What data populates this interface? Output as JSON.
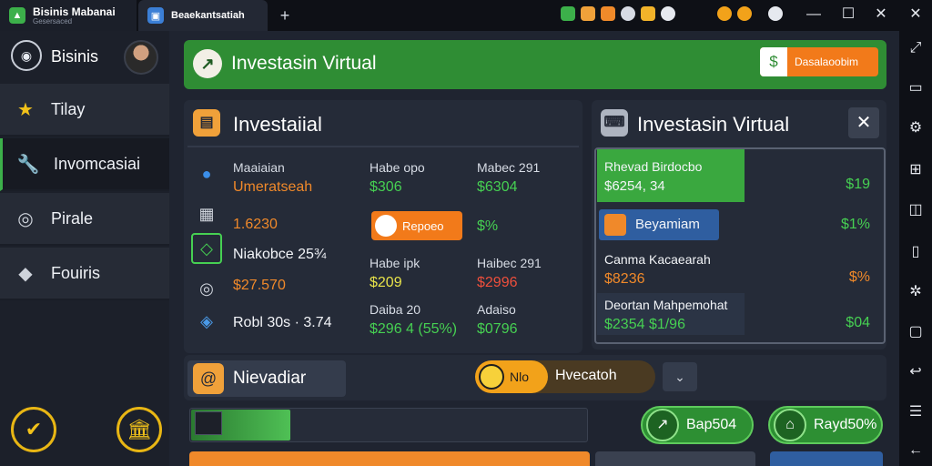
{
  "window": {
    "tab1_title": "Bisinis Mabanai",
    "tab1_sub": "Gesersaced",
    "tab2_title": "Beaekantsatiah",
    "new_tab": "+",
    "controls": {
      "minimize": "—",
      "maximize": "☐",
      "close": "✕"
    }
  },
  "sidebar": {
    "header_label": "Bisinis",
    "items": [
      {
        "label": "Tilay",
        "icon": "star-icon"
      },
      {
        "label": "Invomcasiai",
        "icon": "wrench-icon"
      },
      {
        "label": "Pirale",
        "icon": "pin-icon"
      },
      {
        "label": "Fouiris",
        "icon": "tag-icon"
      }
    ],
    "bottom_buttons": [
      "check-icon",
      "bank-icon"
    ]
  },
  "banner": {
    "title": "Investasin Virtual",
    "button_label": "Dasalaoobim",
    "accent": "#2f8d34",
    "button_color": "#f27a1a"
  },
  "invest_panel": {
    "title": "Investaiial",
    "rows": [
      {
        "label": "Maaiaian",
        "value": "Umeratseah"
      },
      {
        "value": "1.6230"
      },
      {
        "label": "Niakobce 25¾"
      },
      {
        "value": "$27.570"
      },
      {
        "label": "Robl 30s · 3.74"
      }
    ],
    "col2": [
      {
        "label": "Habe opo",
        "value": "$306"
      },
      {
        "badge": "Repoeo"
      },
      {
        "label": "Habe ipk",
        "value": "$209"
      },
      {
        "label": "Daiba 20",
        "value": "$296 4 (55%)"
      }
    ],
    "col3": [
      {
        "label": "Mabec 291",
        "value": "$6304"
      },
      {
        "value": "$%"
      },
      {
        "label": "Haibec 291",
        "value": "$2996"
      },
      {
        "label": "Adaiso",
        "value": "$0796"
      }
    ]
  },
  "virtual_panel": {
    "title": "Investasin Virtual",
    "rows": [
      {
        "line1": "Rhevad Birdocbo",
        "line2": "$6254, 34",
        "value": "$19"
      },
      {
        "line1": "Beyamiam",
        "value": "$1%"
      },
      {
        "line1": "Canma Kacaearah",
        "line2": "$8236",
        "value": "$%"
      },
      {
        "line1": "Deortan Mahpemohat",
        "line2": "$2354  $1/96",
        "value": "$04"
      }
    ]
  },
  "bottom_bar": {
    "left_label": "Nievadiar",
    "pill_badge": "Nlo",
    "pill_label": "Hvecatoh"
  },
  "action_buttons": [
    {
      "label": "Bap504",
      "icon": "chart-icon"
    },
    {
      "label": "Rayd50%",
      "icon": "home-icon"
    }
  ],
  "progress": {
    "fraction": 0.25
  }
}
